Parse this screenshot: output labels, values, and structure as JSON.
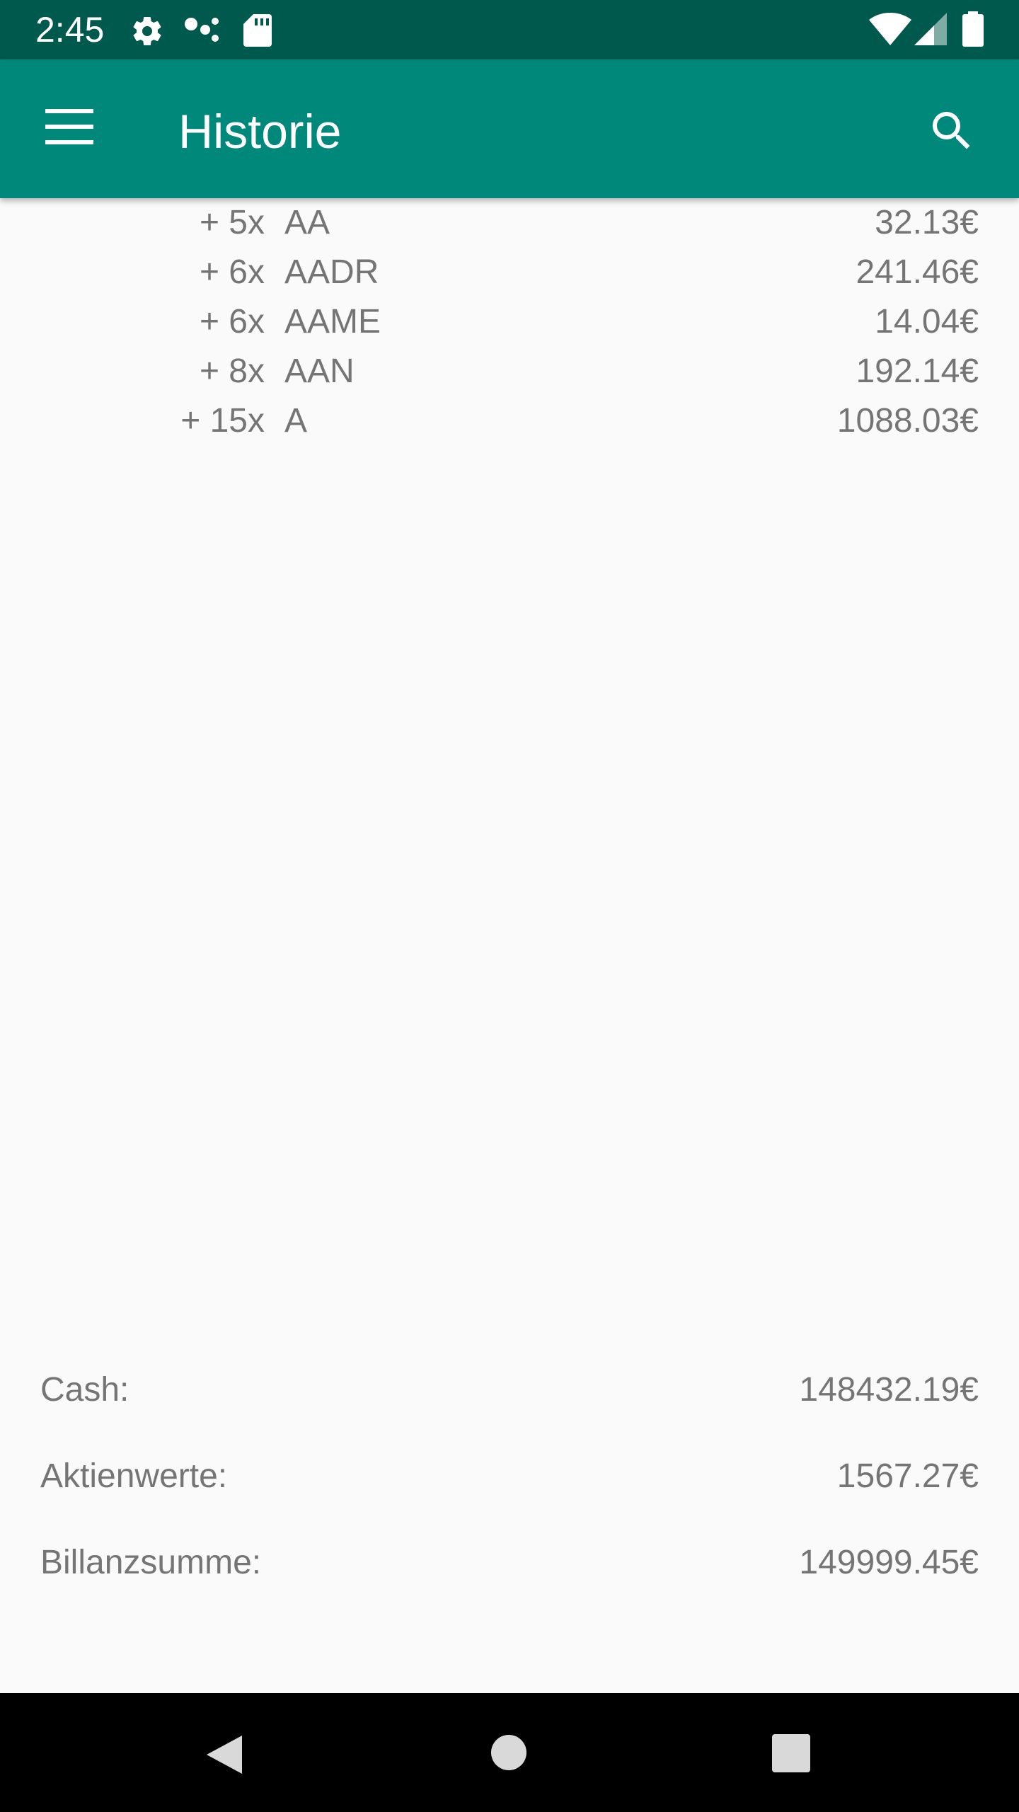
{
  "status_bar": {
    "time": "2:45",
    "icons": [
      "gear-icon",
      "dots-icon",
      "sd-card-icon",
      "wifi-icon",
      "cell-signal-icon",
      "battery-icon"
    ],
    "background_color": "#00594d"
  },
  "app_bar": {
    "title": "Historie",
    "background_color": "#00897b",
    "menu_icon": "hamburger-menu-icon",
    "search_icon": "search-icon"
  },
  "transactions": [
    {
      "quantity": "+ 5x",
      "symbol": "AA",
      "price": "32.13€"
    },
    {
      "quantity": "+ 6x",
      "symbol": "AADR",
      "price": "241.46€"
    },
    {
      "quantity": "+ 6x",
      "symbol": "AAME",
      "price": "14.04€"
    },
    {
      "quantity": "+ 8x",
      "symbol": "AAN",
      "price": "192.14€"
    },
    {
      "quantity": "+ 15x",
      "symbol": "A",
      "price": "1088.03€"
    }
  ],
  "summary": {
    "cash_label": "Cash:",
    "cash_value": "148432.19€",
    "stocks_label": "Aktienwerte:",
    "stocks_value": "1567.27€",
    "total_label": "Billanzsumme:",
    "total_value": "149999.45€"
  },
  "nav_bar": {
    "icons": [
      "back-icon",
      "home-icon",
      "recents-icon"
    ]
  }
}
